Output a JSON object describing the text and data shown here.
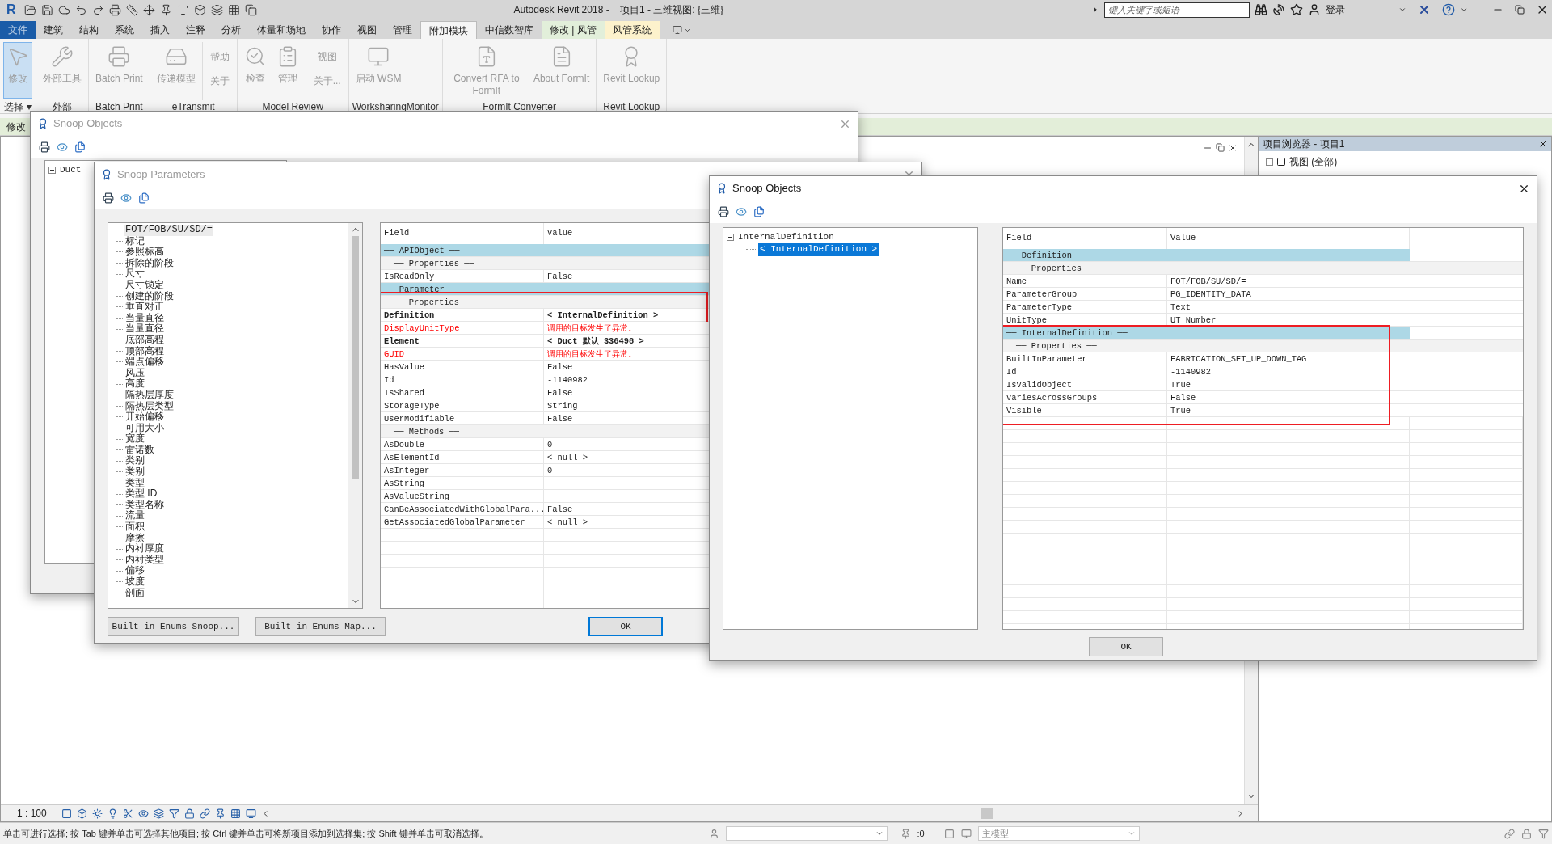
{
  "app": {
    "logo": "R",
    "title": "Autodesk Revit 2018 -    项目1 - 三维视图: {三维}",
    "search": {
      "placeholder": "键入关键字或短语"
    },
    "sign_in": "登录"
  },
  "ribbon_tabs": [
    {
      "label": "文件",
      "kind": "file",
      "selected": false
    },
    {
      "label": "建筑",
      "kind": "tab",
      "selected": false
    },
    {
      "label": "结构",
      "kind": "tab",
      "selected": false
    },
    {
      "label": "系统",
      "kind": "tab",
      "selected": false
    },
    {
      "label": "插入",
      "kind": "tab",
      "selected": false
    },
    {
      "label": "注释",
      "kind": "tab",
      "selected": false
    },
    {
      "label": "分析",
      "kind": "tab",
      "selected": false
    },
    {
      "label": "体量和场地",
      "kind": "tab",
      "selected": false
    },
    {
      "label": "协作",
      "kind": "tab",
      "selected": false
    },
    {
      "label": "视图",
      "kind": "tab",
      "selected": false
    },
    {
      "label": "管理",
      "kind": "tab",
      "selected": false
    },
    {
      "label": "附加模块",
      "kind": "tab",
      "selected": true
    },
    {
      "label": "中信数智库",
      "kind": "tab",
      "selected": false
    },
    {
      "label": "修改 | 风管",
      "kind": "contextual",
      "color": "#e2efda",
      "selected": false
    },
    {
      "label": "风管系统",
      "kind": "contextual",
      "color": "#fdf2cc",
      "selected": false
    }
  ],
  "ribbon_panels": [
    {
      "label": "选择 ▾",
      "buttons": [
        {
          "label": "修改",
          "kind": "large",
          "selected": true
        }
      ]
    },
    {
      "label": "外部",
      "buttons": [
        {
          "label": "外部工具",
          "kind": "large",
          "selected": false
        }
      ]
    },
    {
      "label": "Batch Print",
      "buttons": [
        {
          "label": "Batch Print",
          "kind": "large",
          "selected": false
        }
      ]
    },
    {
      "label": "eTransmit",
      "buttons": [
        {
          "label": "传递模型",
          "kind": "large",
          "selected": false
        },
        {
          "label": "帮助",
          "kind": "small",
          "selected": false
        },
        {
          "label": "关于",
          "kind": "small",
          "selected": false
        }
      ]
    },
    {
      "label": "Model Review",
      "buttons": [
        {
          "label": "检查",
          "kind": "large",
          "selected": false
        },
        {
          "label": "管理",
          "kind": "large",
          "selected": false
        },
        {
          "label": "视图",
          "kind": "small",
          "selected": false
        },
        {
          "label": "关于...",
          "kind": "small",
          "selected": false
        }
      ]
    },
    {
      "label": "WorksharingMonitor",
      "buttons": [
        {
          "label": "启动 WSM",
          "kind": "large",
          "selected": false
        }
      ]
    },
    {
      "label": "FormIt Converter",
      "buttons": [
        {
          "label": "Convert RFA to FormIt",
          "kind": "large",
          "selected": false
        },
        {
          "label": "About FormIt",
          "kind": "large",
          "selected": false
        }
      ]
    },
    {
      "label": "Revit Lookup",
      "buttons": [
        {
          "label": "Revit Lookup",
          "kind": "large",
          "selected": false
        }
      ]
    }
  ],
  "options_bar": {
    "label": "修改"
  },
  "project_browser": {
    "title": "项目浏览器 - 项目1",
    "tree": [
      {
        "label": "视图 (全部)",
        "expanded": true
      }
    ]
  },
  "view_bar": {
    "scale": "1 : 100"
  },
  "status_bar": {
    "message": "单击可进行选择; 按 Tab 键并单击可选择其他项目; 按 Ctrl 键并单击可将新项目添加到选择集; 按 Shift 键并单击可取消选择。",
    "workset": ":0",
    "model": "主模型"
  },
  "dialogs": [
    {
      "kind": "objects_back",
      "title": "Snoop Objects",
      "active": false,
      "tree": [
        {
          "label": "Duct",
          "expanded": true,
          "selected": false
        }
      ]
    },
    {
      "kind": "parameters",
      "title": "Snoop Parameters",
      "active": false,
      "list": [
        {
          "label": "FOT/FOB/SU/SD/=",
          "selected": true
        },
        {
          "label": "标记",
          "selected": false
        },
        {
          "label": "参照标高",
          "selected": false
        },
        {
          "label": "拆除的阶段",
          "selected": false
        },
        {
          "label": "尺寸",
          "selected": false
        },
        {
          "label": "尺寸锁定",
          "selected": false
        },
        {
          "label": "创建的阶段",
          "selected": false
        },
        {
          "label": "垂直对正",
          "selected": false
        },
        {
          "label": "当量直径",
          "selected": false
        },
        {
          "label": "当量直径",
          "selected": false
        },
        {
          "label": "底部高程",
          "selected": false
        },
        {
          "label": "顶部高程",
          "selected": false
        },
        {
          "label": "端点偏移",
          "selected": false
        },
        {
          "label": "风压",
          "selected": false
        },
        {
          "label": "高度",
          "selected": false
        },
        {
          "label": "隔热层厚度",
          "selected": false
        },
        {
          "label": "隔热层类型",
          "selected": false
        },
        {
          "label": "开始偏移",
          "selected": false
        },
        {
          "label": "可用大小",
          "selected": false
        },
        {
          "label": "宽度",
          "selected": false
        },
        {
          "label": "雷诺数",
          "selected": false
        },
        {
          "label": "类别",
          "selected": false
        },
        {
          "label": "类别",
          "selected": false
        },
        {
          "label": "类型",
          "selected": false
        },
        {
          "label": "类型 ID",
          "selected": false
        },
        {
          "label": "类型名称",
          "selected": false
        },
        {
          "label": "流量",
          "selected": false
        },
        {
          "label": "面积",
          "selected": false
        },
        {
          "label": "摩擦",
          "selected": false
        },
        {
          "label": "内衬厚度",
          "selected": false
        },
        {
          "label": "内衬类型",
          "selected": false
        },
        {
          "label": "偏移",
          "selected": false
        },
        {
          "label": "坡度",
          "selected": false
        },
        {
          "label": "剖面",
          "selected": false
        }
      ],
      "columns": [
        "Field",
        "Value"
      ],
      "row_groups": [
        {
          "annotated": false,
          "rows": [
            {
              "kind": "group",
              "field": "── APIObject ──"
            },
            {
              "kind": "subgroup",
              "field": "── Properties ──"
            },
            {
              "kind": "field",
              "field": "IsReadOnly",
              "value": "False"
            },
            {
              "kind": "group",
              "field": "── Parameter ──"
            }
          ]
        },
        {
          "annotated": true,
          "rows": [
            {
              "kind": "subgroup",
              "field": "── Properties ──"
            },
            {
              "kind": "link",
              "field": "Definition",
              "value": "< InternalDefinition >"
            }
          ]
        },
        {
          "annotated": false,
          "rows": [
            {
              "kind": "error",
              "field": "DisplayUnitType",
              "value": "调用的目标发生了异常。"
            },
            {
              "kind": "link",
              "field": "Element",
              "value": "< Duct  默认  336498 >"
            },
            {
              "kind": "error",
              "field": "GUID",
              "value": "调用的目标发生了异常。"
            },
            {
              "kind": "field",
              "field": "HasValue",
              "value": "False"
            },
            {
              "kind": "field",
              "field": "Id",
              "value": "-1140982"
            },
            {
              "kind": "field",
              "field": "IsShared",
              "value": "False"
            },
            {
              "kind": "field",
              "field": "StorageType",
              "value": "String"
            },
            {
              "kind": "field",
              "field": "UserModifiable",
              "value": "False"
            },
            {
              "kind": "subgroup",
              "field": "── Methods ──"
            },
            {
              "kind": "field",
              "field": "AsDouble",
              "value": "0"
            },
            {
              "kind": "field",
              "field": "AsElementId",
              "value": "< null >"
            },
            {
              "kind": "field",
              "field": "AsInteger",
              "value": "0"
            },
            {
              "kind": "field",
              "field": "AsString"
            },
            {
              "kind": "field",
              "field": "AsValueString"
            },
            {
              "kind": "field",
              "field": "CanBeAssociatedWithGlobalPara...",
              "value": "False"
            },
            {
              "kind": "field",
              "field": "GetAssociatedGlobalParameter",
              "value": "< null >"
            }
          ]
        }
      ],
      "buttons": [
        {
          "label": "Built-in Enums Snoop...",
          "focused": false
        },
        {
          "label": "Built-in Enums Map...",
          "focused": false
        },
        {
          "label": "OK",
          "focused": true
        }
      ]
    },
    {
      "kind": "objects",
      "title": "Snoop Objects",
      "active": true,
      "tree": [
        {
          "label": "InternalDefinition",
          "expanded": true,
          "selected": false,
          "children": [
            {
              "label": "< InternalDefinition >",
              "selected": true
            }
          ]
        }
      ],
      "columns": [
        "Field",
        "Value"
      ],
      "row_groups": [
        {
          "annotated": false,
          "rows": [
            {
              "kind": "group",
              "field": "── Definition ──"
            },
            {
              "kind": "subgroup",
              "field": "── Properties ──"
            },
            {
              "kind": "field",
              "field": "Name",
              "value": "FOT/FOB/SU/SD/="
            },
            {
              "kind": "field",
              "field": "ParameterGroup",
              "value": "PG_IDENTITY_DATA"
            },
            {
              "kind": "field",
              "field": "ParameterType",
              "value": "Text"
            },
            {
              "kind": "field",
              "field": "UnitType",
              "value": "UT_Number"
            }
          ]
        },
        {
          "annotated": true,
          "rows": [
            {
              "kind": "group",
              "field": "── InternalDefinition ──"
            },
            {
              "kind": "subgroup",
              "field": "── Properties ──"
            },
            {
              "kind": "field",
              "field": "BuiltInParameter",
              "value": "FABRICATION_SET_UP_DOWN_TAG"
            },
            {
              "kind": "field",
              "field": "Id",
              "value": "-1140982"
            },
            {
              "kind": "field",
              "field": "IsValidObject",
              "value": "True"
            },
            {
              "kind": "field",
              "field": "VariesAcrossGroups",
              "value": "False"
            },
            {
              "kind": "field",
              "field": "Visible",
              "value": "True"
            }
          ]
        }
      ],
      "buttons": [
        {
          "label": "OK",
          "focused": false
        }
      ]
    }
  ]
}
